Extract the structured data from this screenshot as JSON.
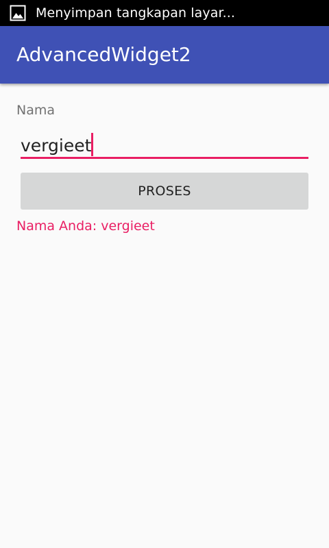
{
  "status_bar": {
    "notification_icon": "image-icon",
    "notification_text": "Menyimpan tangkapan layar..."
  },
  "app_bar": {
    "title": "AdvancedWidget2"
  },
  "form": {
    "name_label": "Nama",
    "name_value": "vergieet",
    "submit_label": "PROSES",
    "result_text": "Nama Anda: vergieet"
  },
  "colors": {
    "primary": "#3f51b5",
    "accent": "#e91e63",
    "background": "#fafafa",
    "button": "#d6d7d7"
  }
}
